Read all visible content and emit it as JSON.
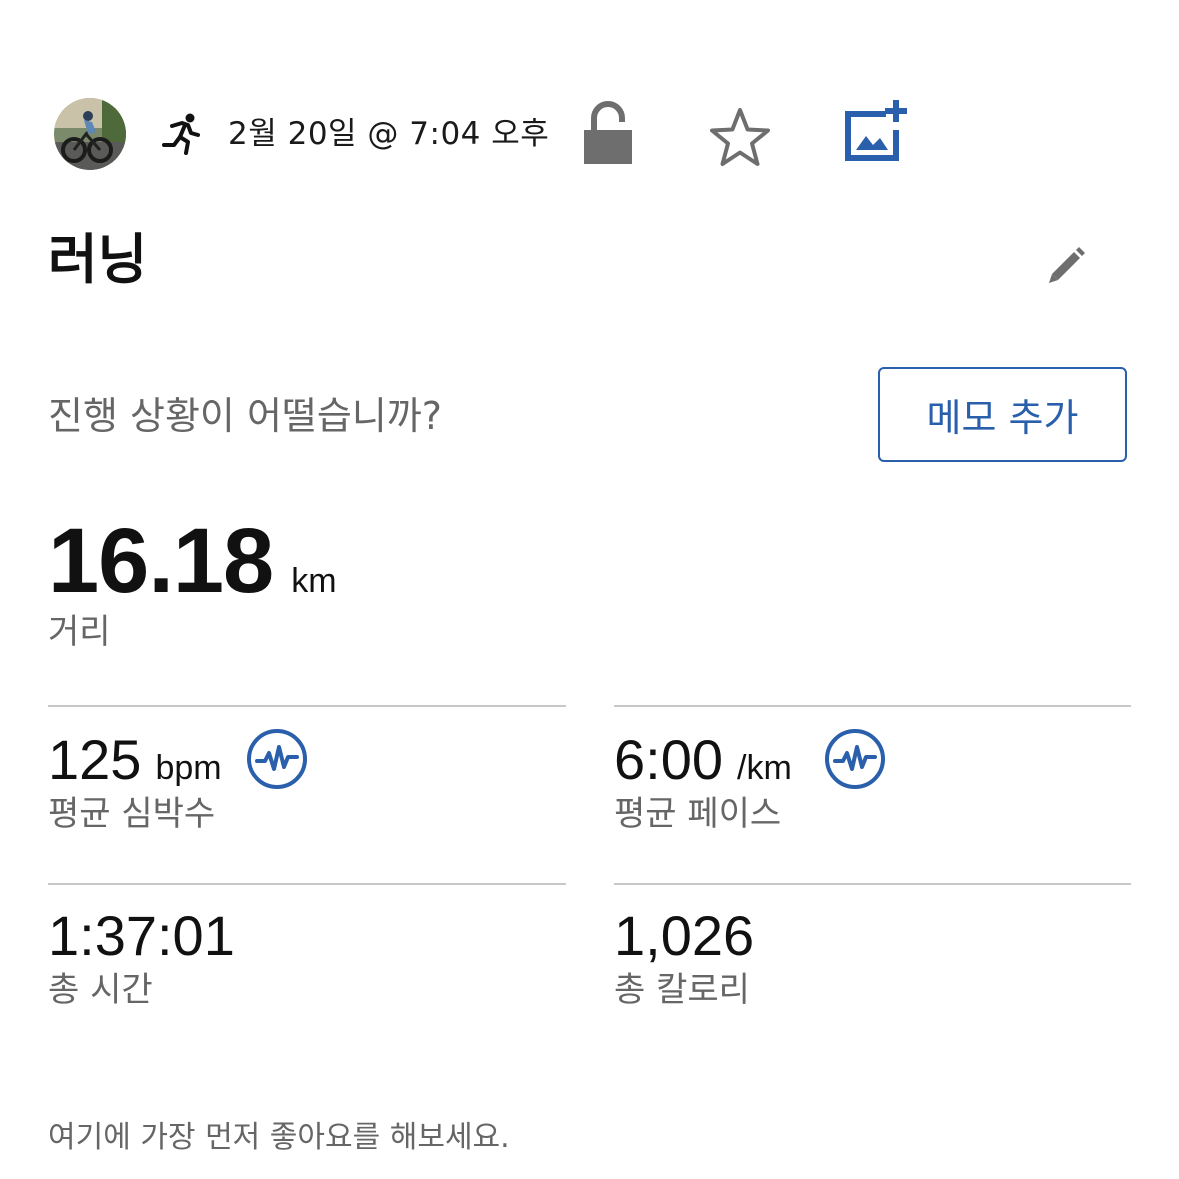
{
  "header": {
    "datetime": "2월 20일 @ 7:04 오후",
    "icons": {
      "avatar": "cyclist-photo-avatar",
      "activity": "running-person-icon",
      "privacy": "unlocked-padlock-icon",
      "favorite": "star-outline-icon",
      "add_photo": "add-photo-icon"
    }
  },
  "activity": {
    "title": "러닝",
    "edit_icon": "pencil-icon"
  },
  "prompt": {
    "question": "진행 상황이 어떨습니까?",
    "memo_button": "메모 추가"
  },
  "distance": {
    "value": "16.18",
    "unit": "km",
    "label": "거리"
  },
  "stats": [
    {
      "value": "125",
      "unit": "bpm",
      "label": "평균 심박수",
      "badge": "heart-rate-icon"
    },
    {
      "value": "6:00",
      "unit": "/km",
      "label": "평균 페이스",
      "badge": "heart-rate-icon"
    },
    {
      "value": "1:37:01",
      "unit": "",
      "label": "총 시간"
    },
    {
      "value": "1,026",
      "unit": "",
      "label": "총 칼로리"
    }
  ],
  "footer": {
    "likes_prompt": "여기에 가장 먼저 좋아요를 해보세요."
  },
  "colors": {
    "accent": "#2a5fab",
    "muted_text": "#666666",
    "icon_gray": "#6e6e6e",
    "divider": "#c8c8c8"
  }
}
